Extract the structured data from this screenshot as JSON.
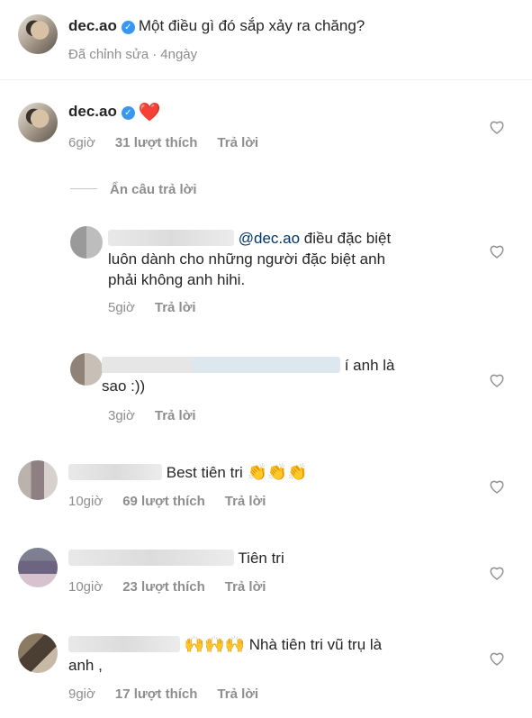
{
  "post": {
    "username": "dec.ao",
    "caption": "Một điều gì đó sắp xảy ra chăng?",
    "edited": "Đã chỉnh sửa",
    "separator": "·",
    "time": "4ngày"
  },
  "comments": [
    {
      "username": "dec.ao",
      "text": "❤️",
      "time": "6giờ",
      "likes": "31 lượt thích",
      "reply": "Trả lời",
      "hide_replies": "Ẩn câu trả lời"
    },
    {
      "mention": "@dec.ao",
      "text_line1": " điều đặc biệt",
      "text_line2": "luôn dành cho những người đặc biệt anh",
      "text_line3": "phải không anh hihi.",
      "time": "5giờ",
      "reply": "Trả lời"
    },
    {
      "text_line1": "í anh là",
      "text_line2": "sao :))",
      "time": "3giờ",
      "reply": "Trả lời"
    },
    {
      "text": "Best tiên tri",
      "emoji": "👏👏👏",
      "time": "10giờ",
      "likes": "69 lượt thích",
      "reply": "Trả lời"
    },
    {
      "text": "Tiên tri",
      "time": "10giờ",
      "likes": "23 lượt thích",
      "reply": "Trả lời"
    },
    {
      "emoji": "🙌🙌🙌",
      "text_line1": "Nhà tiên tri vũ trụ là",
      "text_line2": "anh ,",
      "time": "9giờ",
      "likes": "17 lượt thích",
      "reply": "Trả lời"
    }
  ],
  "icons": {
    "verified": "verified-badge-icon",
    "like": "heart-outline-icon"
  },
  "colors": {
    "primary_text": "#262626",
    "secondary_text": "#8e8e8e",
    "verified": "#3897f0",
    "heart_red": "#ed4956"
  }
}
